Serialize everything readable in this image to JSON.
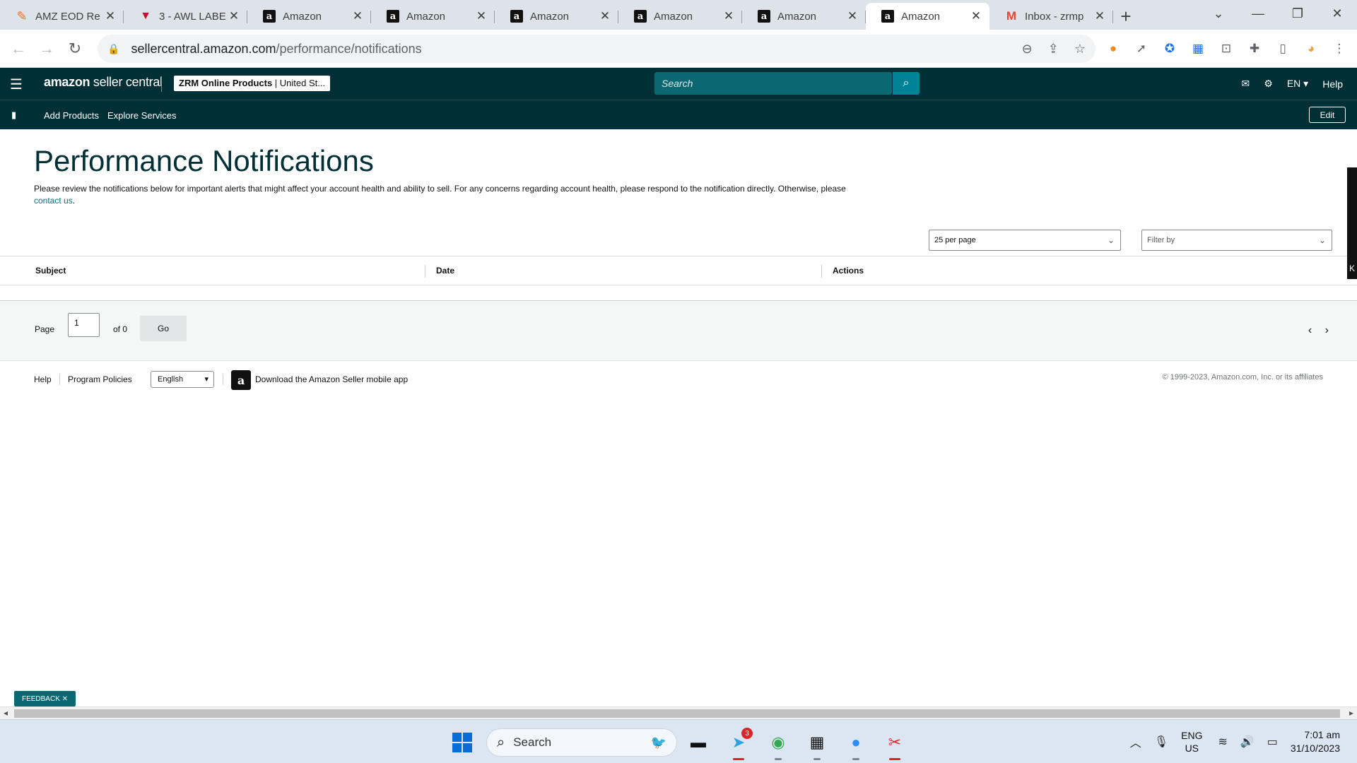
{
  "browser": {
    "tabs": [
      {
        "label": "AMZ EOD Re",
        "icon": "eod-icon",
        "active": false
      },
      {
        "label": "3 - AWL LABE",
        "icon": "awl-icon",
        "active": false
      },
      {
        "label": "Amazon",
        "icon": "amazon-icon",
        "active": false
      },
      {
        "label": "Amazon",
        "icon": "amazon-icon",
        "active": false
      },
      {
        "label": "Amazon",
        "icon": "amazon-icon",
        "active": false
      },
      {
        "label": "Amazon",
        "icon": "amazon-icon",
        "active": false
      },
      {
        "label": "Amazon",
        "icon": "amazon-icon",
        "active": false
      },
      {
        "label": "Amazon",
        "icon": "amazon-icon",
        "active": true
      },
      {
        "label": "Inbox - zrmp",
        "icon": "gmail-icon",
        "active": false
      }
    ],
    "url_host": "sellercentral.amazon.com",
    "url_path": "/performance/notifications"
  },
  "header": {
    "logo_bold": "amazon",
    "logo_rest": " seller central",
    "account_bold": "ZRM Online Products",
    "account_rest": " | United St...",
    "search_placeholder": "Search",
    "lang": "EN ▾",
    "help": "Help"
  },
  "nav": {
    "add_products": "Add Products",
    "explore_services": "Explore Services",
    "edit": "Edit"
  },
  "page": {
    "title": "Performance Notifications",
    "description": "Please review the notifications below for important alerts that might affect your account health and ability to sell. For any concerns regarding account health, please respond to the notification directly. Otherwise, please",
    "contact_link": "contact us",
    "contact_suffix": "."
  },
  "controls": {
    "per_page": "25 per page",
    "filter_by": "Filter by"
  },
  "table": {
    "columns": [
      "Subject",
      "Date",
      "Actions"
    ]
  },
  "pagination": {
    "page_label": "Page",
    "page_value": "1",
    "of_label": "of 0",
    "go": "Go"
  },
  "footer": {
    "help": "Help",
    "program_policies": "Program Policies",
    "language": "English",
    "download_app": "Download the Amazon Seller mobile app",
    "copyright": "© 1999-2023, Amazon.com, Inc. or its affiliates"
  },
  "side_tab_letter": "K",
  "feedback": "FEEDBACK ✕",
  "taskbar": {
    "search": "Search",
    "telegram_badge": "3",
    "lang_line1": "ENG",
    "lang_line2": "US",
    "time": "7:01 am",
    "date": "31/10/2023"
  },
  "colors": {
    "header_bg": "#002f36",
    "search_bg": "#0b6771",
    "accent": "#008296",
    "link": "#007185"
  }
}
